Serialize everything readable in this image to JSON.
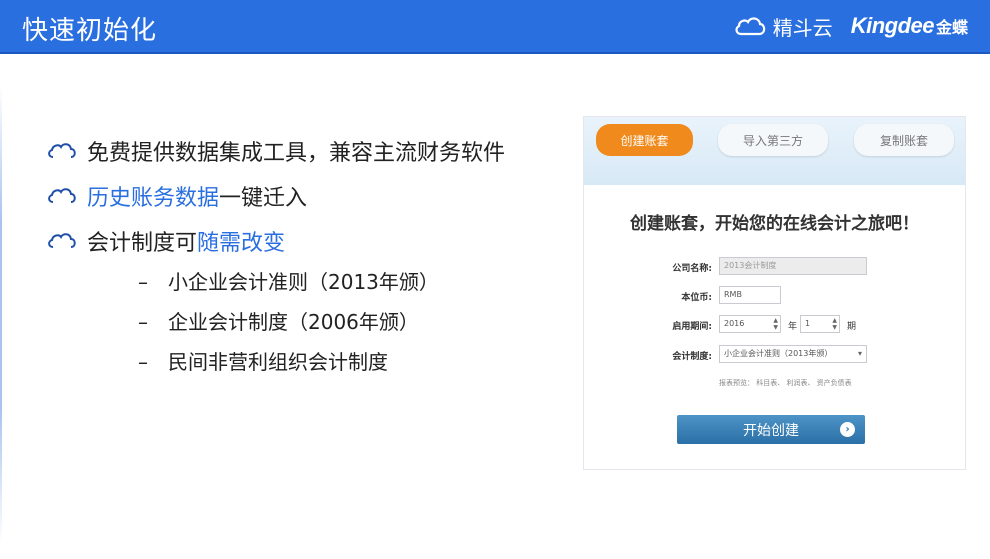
{
  "header": {
    "title": "快速初始化",
    "brand_product": "精斗云",
    "brand_logo_text": "Kingdee",
    "brand_logo_cn": "金蝶"
  },
  "bullets": [
    {
      "segments": [
        {
          "text": "免费提供数据集成工具，兼容主流财务软件",
          "highlight": false
        }
      ]
    },
    {
      "segments": [
        {
          "text": "历史账务数据",
          "highlight": true
        },
        {
          "text": "一键迁入",
          "highlight": false
        }
      ]
    },
    {
      "segments": [
        {
          "text": "会计制度可",
          "highlight": false
        },
        {
          "text": "随需改变",
          "highlight": true
        }
      ]
    }
  ],
  "sub_items": [
    {
      "dash": "–",
      "text": "小企业会计准则（2013年颁）"
    },
    {
      "dash": "–",
      "text": "企业会计制度（2006年颁）"
    },
    {
      "dash": "–",
      "text": "民间非营利组织会计制度"
    }
  ],
  "app": {
    "tabs": [
      {
        "label": "创建账套",
        "active": true
      },
      {
        "label": "导入第三方",
        "active": false
      },
      {
        "label": "复制账套",
        "active": false
      }
    ],
    "form_title": "创建账套，开始您的在线会计之旅吧！",
    "fields": {
      "company_label": "公司名称:",
      "company_value": "2013会计制度",
      "currency_label": "本位币:",
      "currency_value": "RMB",
      "start_label": "启用期间:",
      "year_value": "2016",
      "year_unit": "年",
      "period_value": "1",
      "period_unit": "期",
      "system_label": "会计制度:",
      "system_value": "小企业会计准则（2013年颁）"
    },
    "report_note": "报表预览：  科目表、  利润表、  资产负债表",
    "start_button": "开始创建"
  },
  "colors": {
    "header_bg": "#2a6fe0",
    "highlight": "#2a6fe0",
    "active_tab": "#f08a1c",
    "start_button": "#3a80b8"
  },
  "icons": {
    "bullet": "cloud-outline-icon",
    "brand": "cloud-logo-icon",
    "button": "arrow-right-circle-icon"
  }
}
